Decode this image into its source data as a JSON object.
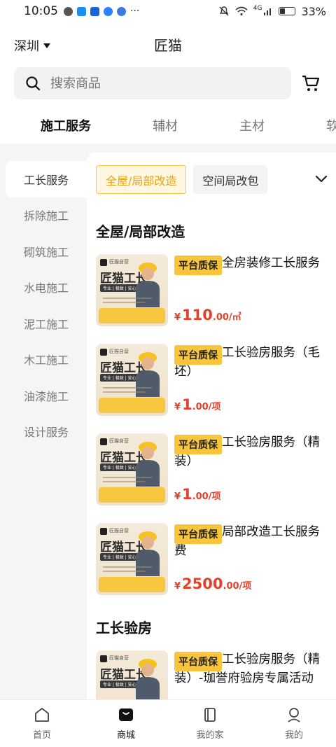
{
  "status": {
    "time": "10:05",
    "signal": "4G",
    "battery": "33%"
  },
  "header": {
    "city": "深圳",
    "title": "匠猫"
  },
  "search": {
    "placeholder": "搜索商品"
  },
  "category_tabs": [
    "施工服务",
    "辅材",
    "主材",
    "软"
  ],
  "sidebar": [
    "工长服务",
    "拆除施工",
    "砌筑施工",
    "水电施工",
    "泥工施工",
    "木工施工",
    "油漆施工",
    "设计服务"
  ],
  "chips": [
    "全屋/局部改造",
    "空间局改包"
  ],
  "sections": [
    {
      "title": "全屋/局部改造"
    },
    {
      "title": "工长验房"
    }
  ],
  "thumb": {
    "brand": "匠猫自营",
    "name": "匠猫工长",
    "sub": "专业 | 极致 | 安心"
  },
  "products": [
    {
      "badge": "平台质保",
      "name": "全房装修工长服务",
      "currency": "¥",
      "price_int": "110",
      "price_dec": ".00/㎡"
    },
    {
      "badge": "平台质保",
      "name": "工长验房服务（毛坯）",
      "currency": "¥",
      "price_int": "1",
      "price_dec": ".00/项"
    },
    {
      "badge": "平台质保",
      "name": "工长验房服务（精装）",
      "currency": "¥",
      "price_int": "1",
      "price_dec": ".00/项"
    },
    {
      "badge": "平台质保",
      "name": "局部改造工长服务费",
      "currency": "¥",
      "price_int": "2500",
      "price_dec": ".00/项"
    },
    {
      "badge": "平台质保",
      "name": "工长验房服务（精装）-珈誉府验房专属活动",
      "currency": "",
      "price_int": "",
      "price_dec": ""
    }
  ],
  "tabbar": [
    "首页",
    "商城",
    "我的家",
    "我的"
  ],
  "colors": {
    "accent": "#f8c53a",
    "price": "#e6402a",
    "chip_active_text": "#e9a316"
  }
}
